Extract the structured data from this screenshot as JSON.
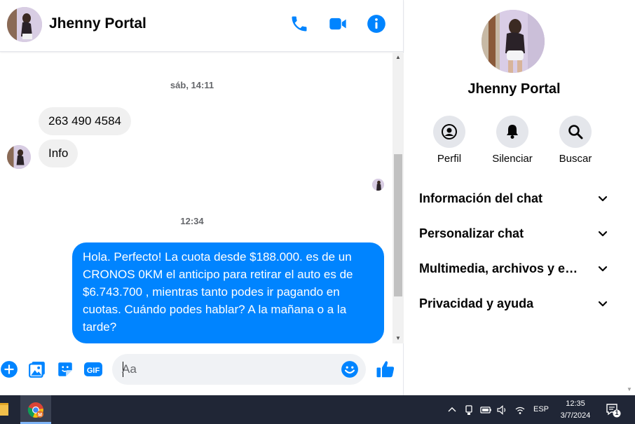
{
  "contact": {
    "name": "Jhenny Portal"
  },
  "header": {
    "call_icon": "phone-icon",
    "video_icon": "video-camera-icon",
    "info_icon": "info-icon"
  },
  "messages": {
    "timestamp_1": "sáb, 14:11",
    "incoming": [
      "263 490 4584",
      "Info"
    ],
    "timestamp_2": "12:34",
    "outgoing": "Hola. Perfecto! La cuota desde $188.000. es de un CRONOS 0KM el anticipo para retirar el auto es de $6.743.700 , mientras tanto podes ir pagando en cuotas. Cuándo podes hablar? A la mañana o a la tarde?"
  },
  "composer": {
    "placeholder": "Aa",
    "icons": [
      "plus-circle-icon",
      "image-icon",
      "sticker-icon",
      "gif-icon",
      "emoji-icon",
      "like-icon"
    ],
    "gif_label": "GIF"
  },
  "panel": {
    "name": "Jhenny Portal",
    "actions": [
      {
        "label": "Perfil",
        "icon": "profile-icon"
      },
      {
        "label": "Silenciar",
        "icon": "bell-icon"
      },
      {
        "label": "Buscar",
        "icon": "search-icon"
      }
    ],
    "sections": [
      "Información del chat",
      "Personalizar chat",
      "Multimedia, archivos y enlaces",
      "Privacidad y ayuda"
    ]
  },
  "taskbar": {
    "language": "ESP",
    "time": "12:35",
    "date": "3/7/2024",
    "notification_count": "1"
  },
  "colors": {
    "accent": "#0084ff",
    "incoming_bubble": "#f0f0f0",
    "taskbar": "#202636"
  }
}
